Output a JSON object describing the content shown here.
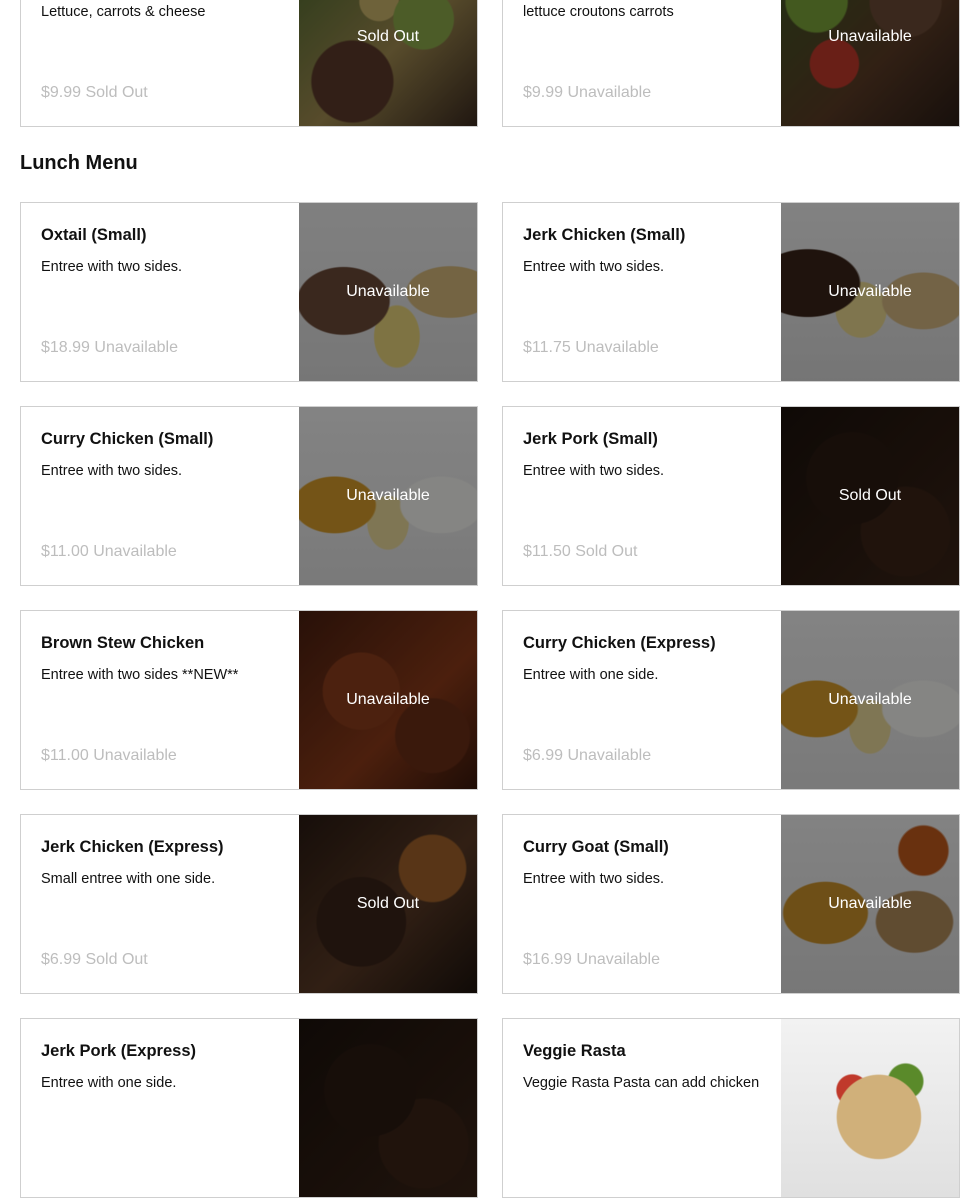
{
  "top_items": [
    {
      "name": "",
      "description": "Lettuce, carrots & cheese",
      "price": "$9.99 Sold Out",
      "status": "Sold Out",
      "photo": "salad-a"
    },
    {
      "name": "",
      "description": "lettuce croutons carrots",
      "price": "$9.99 Unavailable",
      "status": "Unavailable",
      "photo": "salad-b"
    }
  ],
  "lunch_menu": {
    "title": "Lunch Menu",
    "items": [
      {
        "name": "Oxtail (Small)",
        "description": "Entree with two sides.",
        "price": "$18.99 Unavailable",
        "status": "Unavailable"
      },
      {
        "name": "Jerk Chicken (Small)",
        "description": "Entree with two sides.",
        "price": "$11.75 Unavailable",
        "status": "Unavailable"
      },
      {
        "name": "Curry Chicken (Small)",
        "description": "Entree with two sides.",
        "price": "$11.00 Unavailable",
        "status": "Unavailable"
      },
      {
        "name": "Jerk Pork (Small)",
        "description": "Entree with two sides.",
        "price": "$11.50 Sold Out",
        "status": "Sold Out"
      },
      {
        "name": "Brown Stew Chicken",
        "description": "Entree with two sides **NEW**",
        "price": "$11.00 Unavailable",
        "status": "Unavailable"
      },
      {
        "name": "Curry Chicken (Express)",
        "description": "Entree with one side.",
        "price": "$6.99 Unavailable",
        "status": "Unavailable"
      },
      {
        "name": "Jerk Chicken (Express)",
        "description": "Small entree with one side.",
        "price": "$6.99 Sold Out",
        "status": "Sold Out"
      },
      {
        "name": "Curry Goat (Small)",
        "description": "Entree with two sides.",
        "price": "$16.99 Unavailable",
        "status": "Unavailable"
      },
      {
        "name": "Jerk Pork (Express)",
        "description": "Entree with one side.",
        "price": "",
        "status": ""
      },
      {
        "name": "Veggie Rasta",
        "description": "Veggie Rasta Pasta can add chicken",
        "price": "",
        "status": ""
      }
    ]
  }
}
